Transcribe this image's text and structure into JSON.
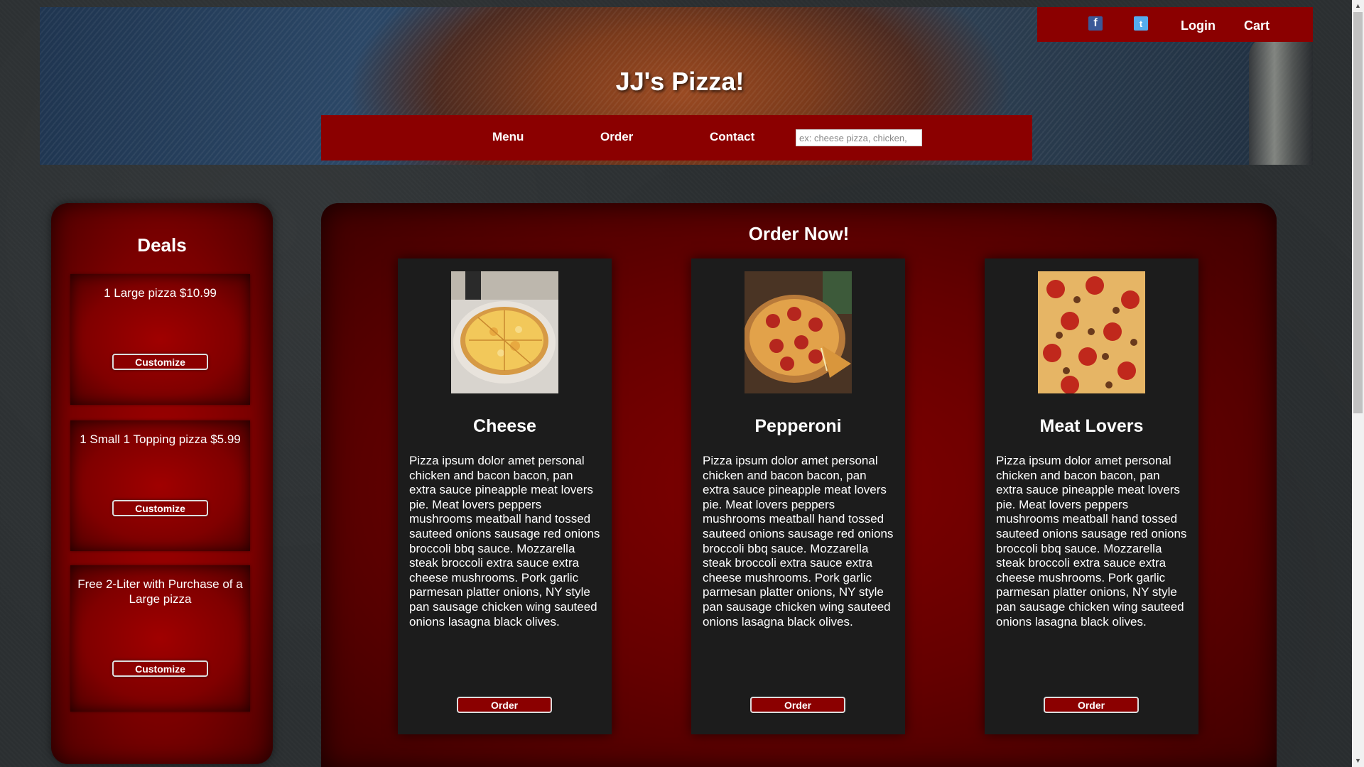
{
  "header": {
    "title": "JJ's Pizza!",
    "login_label": "Login",
    "cart_label": "Cart",
    "facebook_glyph": "f",
    "twitter_glyph": "t"
  },
  "nav": {
    "items": [
      {
        "label": "Menu"
      },
      {
        "label": "Order"
      },
      {
        "label": "Contact"
      }
    ],
    "search_placeholder": "ex: cheese pizza, chicken,"
  },
  "deals": {
    "title": "Deals",
    "items": [
      {
        "text": "1 Large pizza $10.99",
        "button": "Customize"
      },
      {
        "text": "1 Small 1 Topping pizza $5.99",
        "button": "Customize"
      },
      {
        "text": "Free 2-Liter with Purchase of a Large pizza",
        "button": "Customize"
      }
    ]
  },
  "order": {
    "title": "Order Now!",
    "pizzas": [
      {
        "name": "Cheese",
        "description": "Pizza ipsum dolor amet personal chicken and bacon bacon, pan extra sauce pineapple meat lovers pie. Meat lovers peppers mushrooms meatball hand tossed sauteed onions sausage red onions broccoli bbq sauce. Mozzarella steak broccoli extra sauce extra cheese mushrooms. Pork garlic parmesan platter onions, NY style pan sausage chicken wing sauteed onions lasagna black olives.",
        "button": "Order"
      },
      {
        "name": "Pepperoni",
        "description": "Pizza ipsum dolor amet personal chicken and bacon bacon, pan extra sauce pineapple meat lovers pie. Meat lovers peppers mushrooms meatball hand tossed sauteed onions sausage red onions broccoli bbq sauce. Mozzarella steak broccoli extra sauce extra cheese mushrooms. Pork garlic parmesan platter onions, NY style pan sausage chicken wing sauteed onions lasagna black olives.",
        "button": "Order"
      },
      {
        "name": "Meat Lovers",
        "description": "Pizza ipsum dolor amet personal chicken and bacon bacon, pan extra sauce pineapple meat lovers pie. Meat lovers peppers mushrooms meatball hand tossed sauteed onions sausage red onions broccoli bbq sauce. Mozzarella steak broccoli extra sauce extra cheese mushrooms. Pork garlic parmesan platter onions, NY style pan sausage chicken wing sauteed onions lasagna black olives.",
        "button": "Order"
      }
    ]
  },
  "colors": {
    "brand_red": "#8b0000",
    "card_bg": "#1c1c1c",
    "facebook": "#3b5998",
    "twitter": "#55acee"
  },
  "icons": {
    "facebook": "facebook-icon",
    "twitter": "twitter-icon",
    "scroll_up": "scroll-up-arrow-icon",
    "scroll_down": "scroll-down-arrow-icon"
  }
}
